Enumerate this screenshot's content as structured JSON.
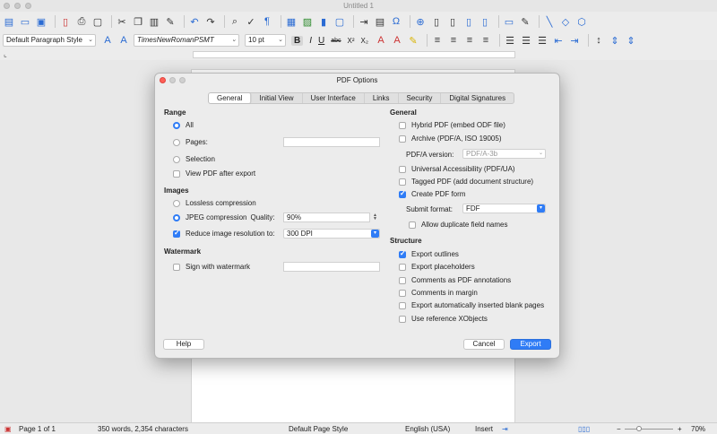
{
  "window": {
    "title": "Untitled 1"
  },
  "toolbar": {
    "paragraph_style": "Default Paragraph Style",
    "font_name": "TimesNewRomanPSMT",
    "font_size": "10 pt"
  },
  "dialog": {
    "title": "PDF Options",
    "tabs": [
      "General",
      "Initial View",
      "User Interface",
      "Links",
      "Security",
      "Digital Signatures"
    ],
    "range": {
      "heading": "Range",
      "all": "All",
      "pages": "Pages:",
      "selection": "Selection",
      "view_after": "View PDF after export"
    },
    "images": {
      "heading": "Images",
      "lossless": "Lossless compression",
      "jpeg": "JPEG compression",
      "quality_label": "Quality:",
      "quality_value": "90%",
      "reduce": "Reduce image resolution to:",
      "resolution": "300 DPI"
    },
    "watermark": {
      "heading": "Watermark",
      "sign": "Sign with watermark"
    },
    "general": {
      "heading": "General",
      "hybrid": "Hybrid PDF (embed ODF file)",
      "archive": "Archive (PDF/A, ISO 19005)",
      "pdfa_label": "PDF/A version:",
      "pdfa_value": "PDF/A-3b",
      "accessibility": "Universal Accessibility (PDF/UA)",
      "tagged": "Tagged PDF (add document structure)",
      "create_form": "Create PDF form",
      "submit_label": "Submit format:",
      "submit_value": "FDF",
      "duplicate": "Allow duplicate field names"
    },
    "structure": {
      "heading": "Structure",
      "outlines": "Export outlines",
      "placeholders": "Export placeholders",
      "comments_pdf": "Comments as PDF annotations",
      "comments_margin": "Comments in margin",
      "blank_pages": "Export automatically inserted blank pages",
      "xobjects": "Use reference XObjects"
    },
    "buttons": {
      "help": "Help",
      "cancel": "Cancel",
      "export": "Export"
    }
  },
  "statusbar": {
    "page": "Page 1 of 1",
    "words": "350 words, 2,354 characters",
    "page_style": "Default Page Style",
    "language": "English (USA)",
    "mode": "Insert",
    "zoom": "70%"
  }
}
